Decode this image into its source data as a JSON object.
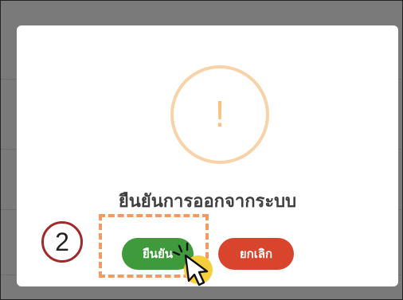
{
  "dialog": {
    "title": "ยืนยันการออกจากระบบ",
    "warning_icon_glyph": "!",
    "confirm_label": "ยืนยัน",
    "cancel_label": "ยกเลิก"
  },
  "annotation": {
    "step_number": "2"
  },
  "colors": {
    "confirm": "#3f9a3b",
    "cancel": "#d9442c",
    "warning": "#f8c083",
    "highlight": "#f39a63",
    "step_ring": "#a12929"
  },
  "icons": [
    "warning-icon",
    "pointer-cursor-icon"
  ]
}
